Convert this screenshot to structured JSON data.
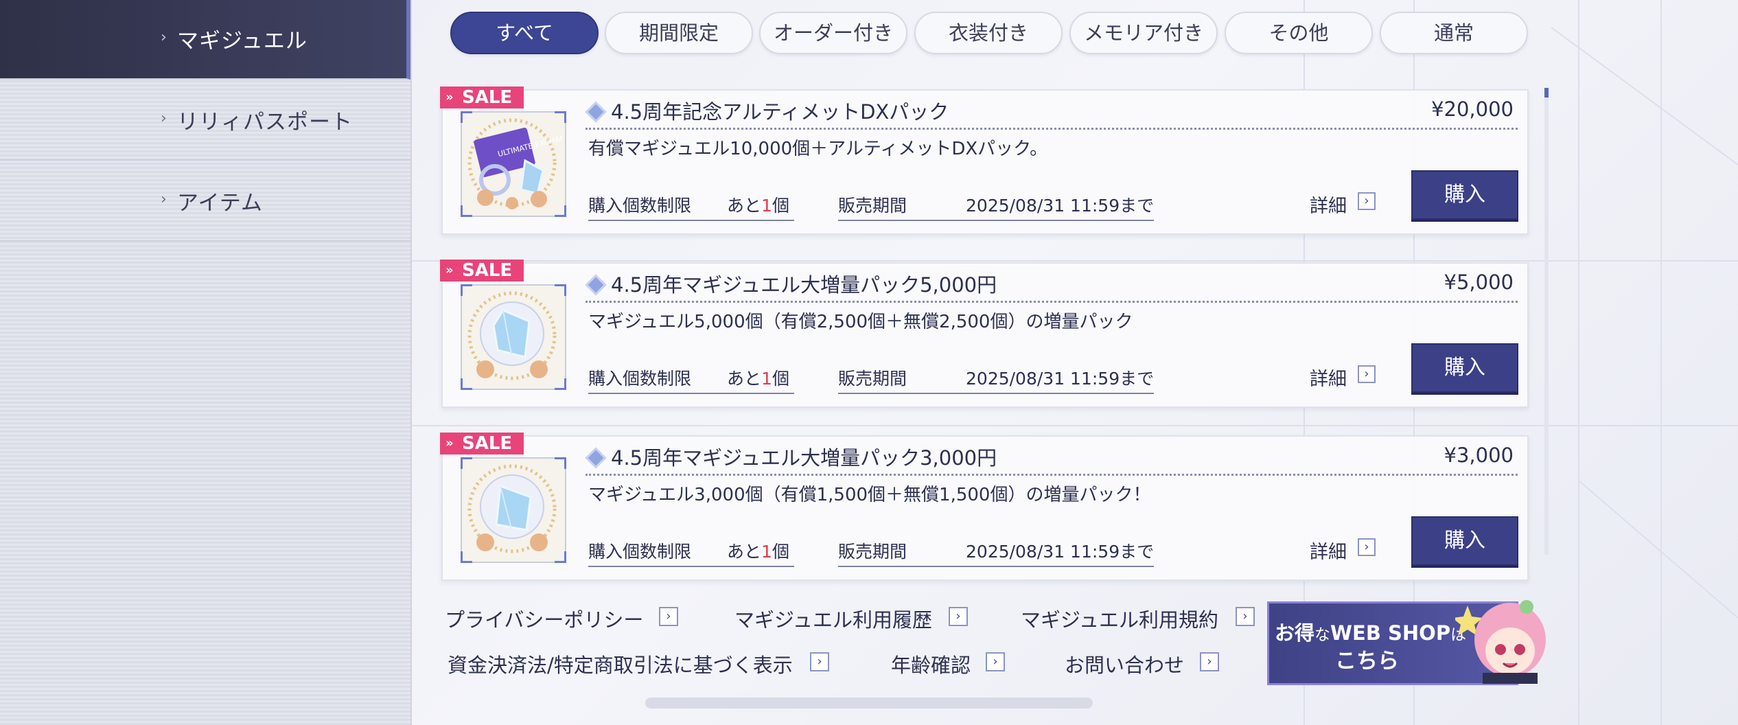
{
  "sidebar": {
    "items": [
      {
        "label": "マギジュエル",
        "active": true
      },
      {
        "label": "リリィパスポート",
        "active": false
      },
      {
        "label": "アイテム",
        "active": false
      }
    ]
  },
  "tabs": [
    {
      "label": "すべて",
      "active": true
    },
    {
      "label": "期間限定",
      "active": false
    },
    {
      "label": "オーダー付き",
      "active": false
    },
    {
      "label": "衣装付き",
      "active": false
    },
    {
      "label": "メモリア付き",
      "active": false
    },
    {
      "label": "その他",
      "active": false
    },
    {
      "label": "通常",
      "active": false
    }
  ],
  "products": [
    {
      "badge": "SALE",
      "title": "4.5周年記念アルティメットDXパック",
      "price": "¥20,000",
      "description": "有償マギジュエル10,000個＋アルティメットDXパック。",
      "limit_label": "購入個数制限",
      "remaining_prefix": "あと",
      "remaining_count": "1",
      "remaining_suffix": "個",
      "period_label": "販売期間",
      "period_value": "2025/08/31 11:59まで",
      "detail_label": "詳細",
      "buy_label": "購入",
      "thumb_badge": "ULTIMATE EXCHANGE"
    },
    {
      "badge": "SALE",
      "title": "4.5周年マギジュエル大増量パック5,000円",
      "price": "¥5,000",
      "description": "マギジュエル5,000個（有償2,500個＋無償2,500個）の増量パック",
      "limit_label": "購入個数制限",
      "remaining_prefix": "あと",
      "remaining_count": "1",
      "remaining_suffix": "個",
      "period_label": "販売期間",
      "period_value": "2025/08/31 11:59まで",
      "detail_label": "詳細",
      "buy_label": "購入"
    },
    {
      "badge": "SALE",
      "title": "4.5周年マギジュエル大増量パック3,000円",
      "price": "¥3,000",
      "description": "マギジュエル3,000個（有償1,500個＋無償1,500個）の増量パック！",
      "limit_label": "購入個数制限",
      "remaining_prefix": "あと",
      "remaining_count": "1",
      "remaining_suffix": "個",
      "period_label": "販売期間",
      "period_value": "2025/08/31 11:59まで",
      "detail_label": "詳細",
      "buy_label": "購入"
    }
  ],
  "footer": {
    "links": [
      "プライバシーポリシー",
      "マギジュエル利用履歴",
      "マギジュエル利用規約",
      "資金決済法/特定商取引法に基づく表示",
      "年齢確認",
      "お問い合わせ"
    ],
    "banner": {
      "line1_a": "お得",
      "line1_b": "な",
      "line1_c": "WEB SHOP",
      "line1_d": "は",
      "line2": "こちら"
    }
  },
  "icons": {
    "chevron": "chevron-right-icon",
    "gem": "gem-icon",
    "mascot": "mascot-character-icon"
  },
  "colors": {
    "accent": "#3d4694",
    "sale": "#e8447a",
    "sidebar_active": "#2f3148",
    "remaining_highlight": "#e03c4c"
  }
}
